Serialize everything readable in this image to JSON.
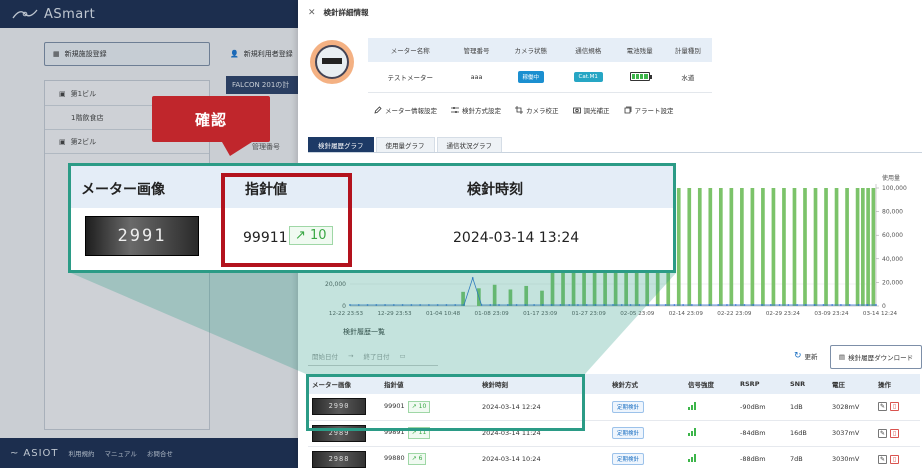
{
  "app": {
    "logo": "ASmart"
  },
  "background": {
    "facility_button": "新規施設登録",
    "user_button": "新規利用者登録",
    "falcon_header": "FALCON 201の計",
    "tree": [
      {
        "label": "第1ビル"
      },
      {
        "label": "1階飲食店"
      },
      {
        "label": "第2ビル"
      }
    ],
    "column_label": "管理番号",
    "footer": {
      "brand": "ASIOT",
      "links": [
        "利用規約",
        "マニュアル",
        "お問合せ"
      ]
    }
  },
  "drawer": {
    "title": "検針詳細情報",
    "info": {
      "headers": [
        "メーター名称",
        "管理番号",
        "カメラ状態",
        "通信規格",
        "電池残量",
        "計量種別"
      ],
      "values": {
        "name": "テストメーター",
        "number": "aaa",
        "camera": "稼働中",
        "comm": "Cat.M1",
        "kind": "水道"
      }
    },
    "actions": [
      "メーター情報設定",
      "検針方式設定",
      "カメラ校正",
      "調光補正",
      "アラート設定"
    ],
    "tabs": [
      "検針履歴グラフ",
      "使用量グラフ",
      "通信状況グラフ"
    ],
    "history_title": "検針履歴一覧",
    "date_start": "開始日付",
    "date_end": "終了日付",
    "refresh": "更新",
    "download": "検針履歴ダウンロード",
    "table": {
      "headers": [
        "メーター画像",
        "指針値",
        "検針時刻",
        "検針方式",
        "信号強度",
        "RSRP",
        "SNR",
        "電圧",
        "操作"
      ],
      "rows": [
        {
          "img": "2990",
          "value": "99901",
          "delta": "10",
          "time": "2024-03-14 12:24",
          "method": "定期検針",
          "rsrp": "-90dBm",
          "snr": "1dB",
          "volt": "3028mV"
        },
        {
          "img": "2989",
          "value": "99891",
          "delta": "11",
          "time": "2024-03-14 11:24",
          "method": "定期検針",
          "rsrp": "-84dBm",
          "snr": "16dB",
          "volt": "3037mV"
        },
        {
          "img": "2988",
          "value": "99880",
          "delta": "6",
          "time": "2024-03-14 10:24",
          "method": "定期検針",
          "rsrp": "-88dBm",
          "snr": "7dB",
          "volt": "3030mV"
        }
      ]
    }
  },
  "callout": {
    "label": "確認"
  },
  "zoom": {
    "headers": [
      "メーター画像",
      "指針値",
      "検針時刻"
    ],
    "img": "2991",
    "value": "99911",
    "delta": "10",
    "time": "2024-03-14 13:24"
  },
  "chart_data": {
    "type": "bar",
    "title": "",
    "ylabel_right": "使用量",
    "y_ticks_left": [
      "20,000",
      "0"
    ],
    "y_ticks_right": [
      "100,000",
      "80,000",
      "60,000",
      "40,000",
      "20,000",
      "0"
    ],
    "x_ticks": [
      "12-22 23:53",
      "12-29 23:53",
      "01-04 10:48",
      "01-08 23:09",
      "01-17 23:09",
      "01-27 23:09",
      "02-05 23:09",
      "02-14 23:09",
      "02-22 23:09",
      "02-29 23:24",
      "03-09 23:24",
      "03-14 12:24"
    ],
    "ylim_right": [
      0,
      100000
    ],
    "bar_color": "#7cc36a",
    "line_color": "#2f6fd3"
  },
  "colors": {
    "accent": "#2b9b86",
    "highlight": "#b3121d",
    "callout": "#c0262c",
    "nav": "#1a2e52"
  }
}
